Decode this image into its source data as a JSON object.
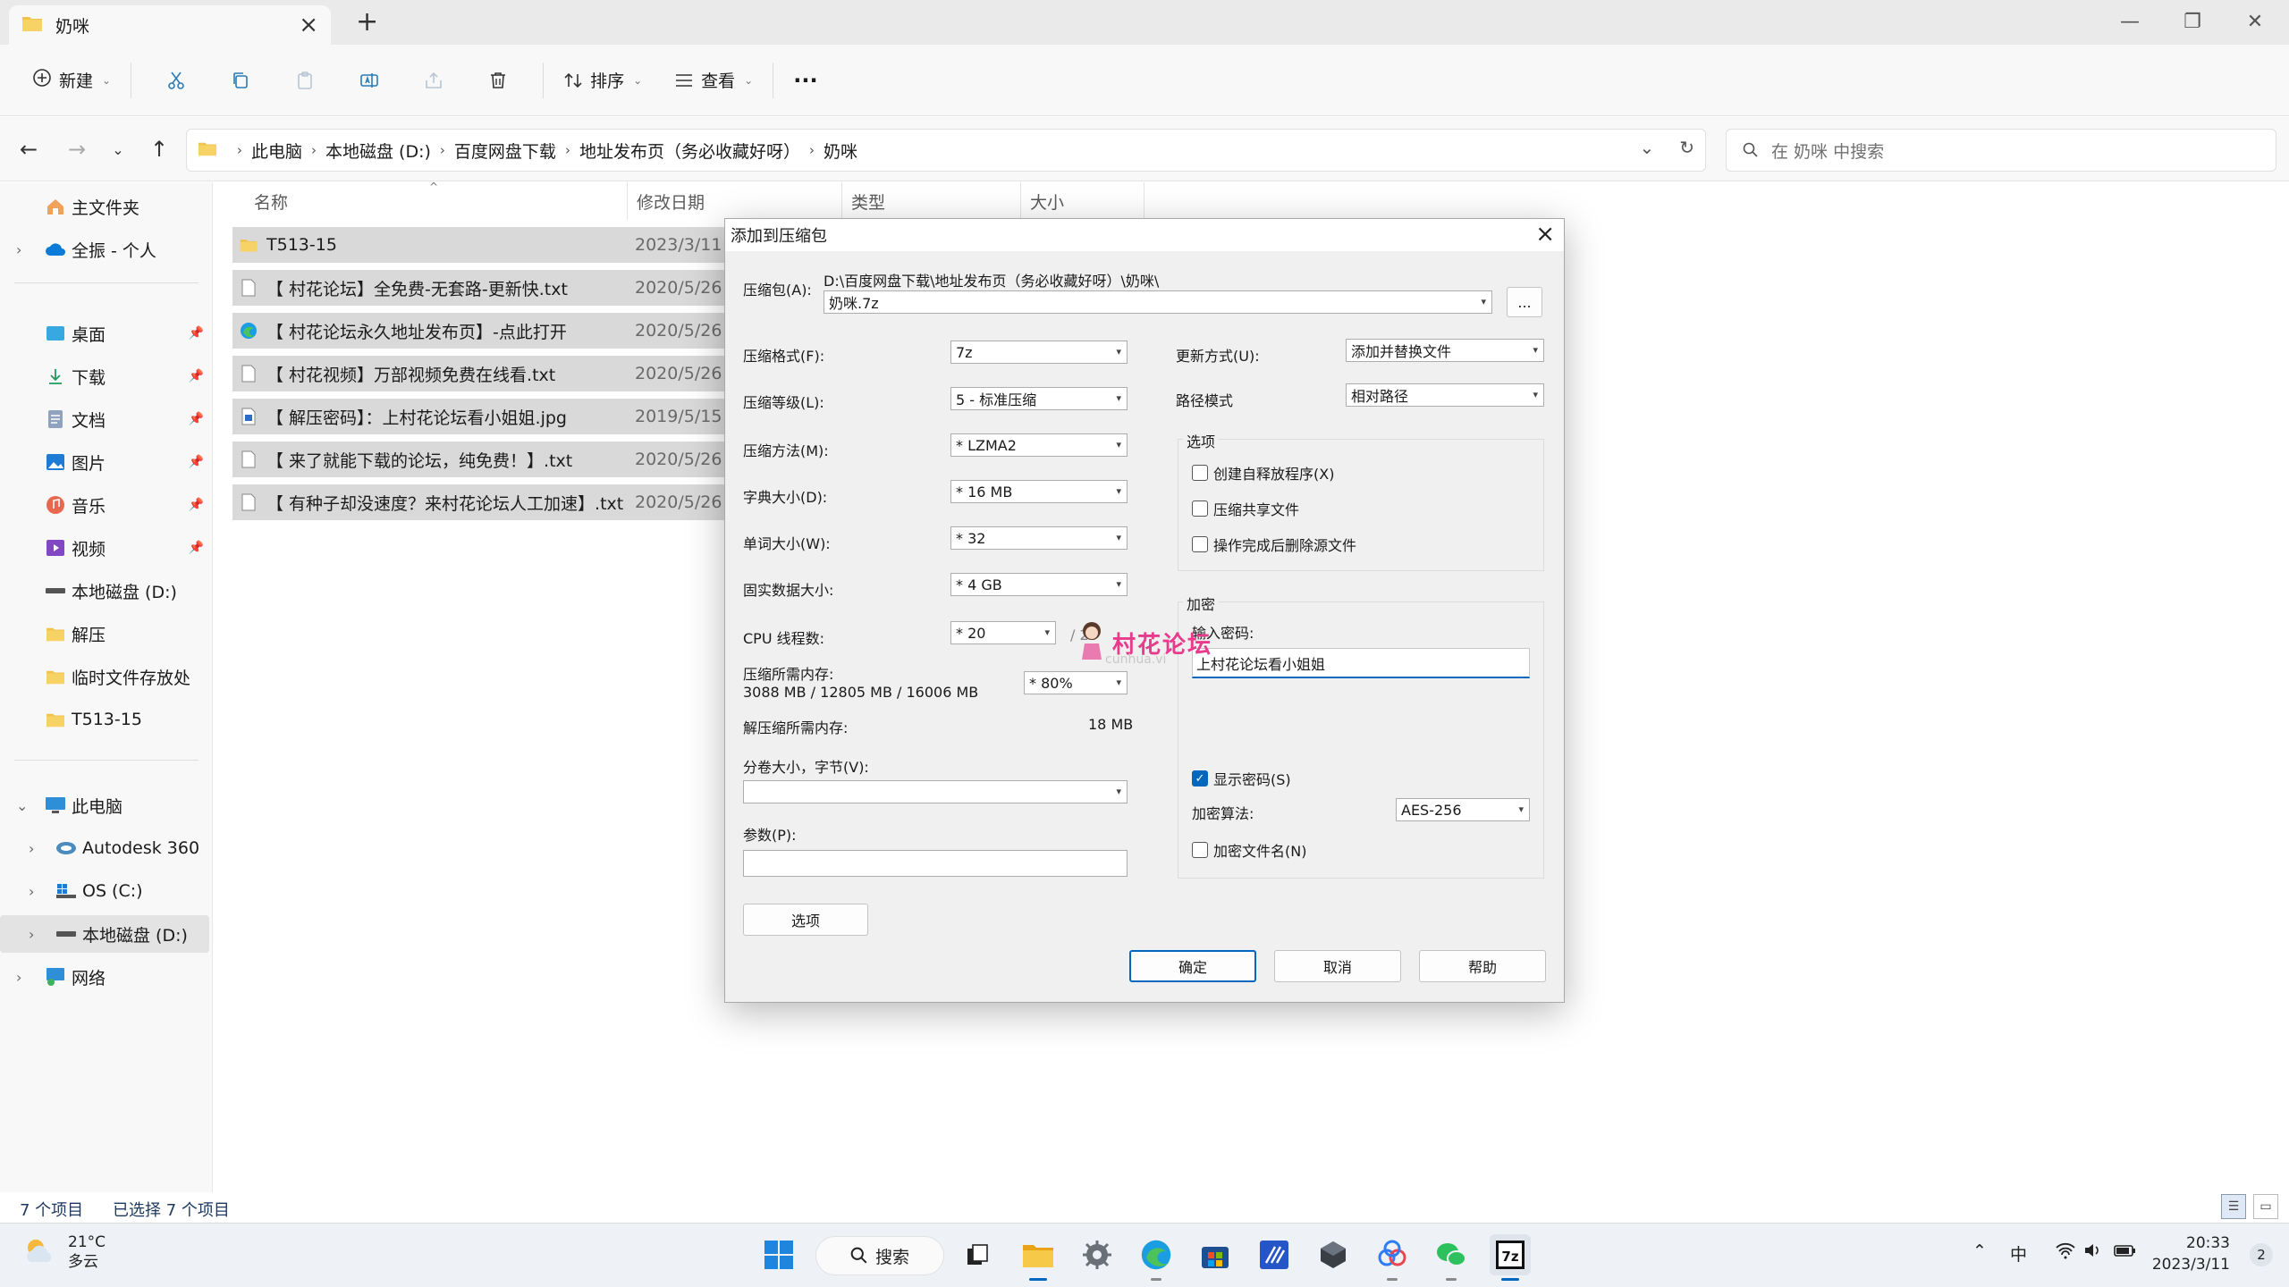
{
  "window": {
    "tab_title": "奶咪"
  },
  "toolbar": {
    "new_label": "新建",
    "sort_label": "排序",
    "view_label": "查看",
    "more_label": "···"
  },
  "address": {
    "crumbs": [
      "此电脑",
      "本地磁盘 (D:)",
      "百度网盘下载",
      "地址发布页（务必收藏好呀）",
      "奶咪"
    ],
    "search_placeholder": "在 奶咪 中搜索"
  },
  "sidebar": {
    "home": "主文件夹",
    "cloud": "全振 - 个人",
    "quick": [
      "桌面",
      "下载",
      "文档",
      "图片",
      "音乐",
      "视频",
      "本地磁盘 (D:)",
      "解压",
      "临时文件存放处",
      "T513-15"
    ],
    "pc": "此电脑",
    "pc_children": [
      "Autodesk 360",
      "OS (C:)",
      "本地磁盘 (D:)"
    ],
    "network": "网络"
  },
  "filelist": {
    "columns": [
      "名称",
      "修改日期",
      "类型",
      "大小"
    ],
    "rows": [
      {
        "name": "T513-15",
        "date": "2023/3/11",
        "kind": "folder"
      },
      {
        "name": "【 村花论坛】全免费-无套路-更新快.txt",
        "date": "2020/5/26 1",
        "kind": "txt"
      },
      {
        "name": "【 村花论坛永久地址发布页】-点此打开",
        "date": "2020/5/26 1",
        "kind": "edge"
      },
      {
        "name": "【 村花视频】万部视频免费在线看.txt",
        "date": "2020/5/26 1",
        "kind": "txt"
      },
      {
        "name": "【 解压密码】：上村花论坛看小姐姐.jpg",
        "date": "2019/5/15 2",
        "kind": "jpg"
      },
      {
        "name": "【 来了就能下载的论坛，纯免费！】.txt",
        "date": "2020/5/26 1",
        "kind": "txt"
      },
      {
        "name": "【 有种子却没速度？来村花论坛人工加速】.txt",
        "date": "2020/5/26 1",
        "kind": "txt"
      }
    ]
  },
  "status": {
    "count": "7 个项目",
    "selected": "已选择 7 个项目"
  },
  "dialog": {
    "title": "添加到压缩包",
    "archive_label": "压缩包(A):",
    "archive_path": "D:\\百度网盘下载\\地址发布页（务必收藏好呀）\\奶咪\\",
    "archive_name": "奶咪.7z",
    "browse_label": "...",
    "format_label": "压缩格式(F):",
    "format_value": "7z",
    "level_label": "压缩等级(L):",
    "level_value": "5 - 标准压缩",
    "method_label": "压缩方法(M):",
    "method_value": "* LZMA2",
    "dict_label": "字典大小(D):",
    "dict_value": "* 16 MB",
    "word_label": "单词大小(W):",
    "word_value": "* 32",
    "solid_label": "固实数据大小:",
    "solid_value": "* 4 GB",
    "threads_label": "CPU 线程数:",
    "threads_value": "* 20",
    "threads_total": "/ 20",
    "mem_label": "压缩所需内存:",
    "mem_value": "3088 MB / 12805 MB / 16006 MB",
    "mem_percent": "* 80%",
    "decomp_label": "解压缩所需内存:",
    "decomp_value": "18 MB",
    "split_label": "分卷大小，字节(V):",
    "params_label": "参数(P):",
    "options_button": "选项",
    "update_label": "更新方式(U):",
    "update_value": "添加并替换文件",
    "path_label": "路径模式",
    "path_value": "相对路径",
    "options_group": "选项",
    "opt_sfx": "创建自释放程序(X)",
    "opt_shared": "压缩共享文件",
    "opt_delete": "操作完成后删除源文件",
    "encrypt_group": "加密",
    "password_label": "输入密码:",
    "password_value": "上村花论坛看小姐姐",
    "show_password": "显示密码(S)",
    "enc_method_label": "加密算法:",
    "enc_method_value": "AES-256",
    "enc_names": "加密文件名(N)",
    "ok": "确定",
    "cancel": "取消",
    "help": "帮助"
  },
  "watermark": {
    "text": "村花论坛",
    "sub": "cunhua.vi"
  },
  "taskbar": {
    "temp": "21°C",
    "weather": "多云",
    "search_label": "搜索",
    "ime": "中",
    "time": "20:33",
    "date": "2023/3/11",
    "notifications": "2"
  },
  "colors": {
    "accent": "#0067c0",
    "selection": "#d9d9d9",
    "folder": "#f2c14e"
  }
}
